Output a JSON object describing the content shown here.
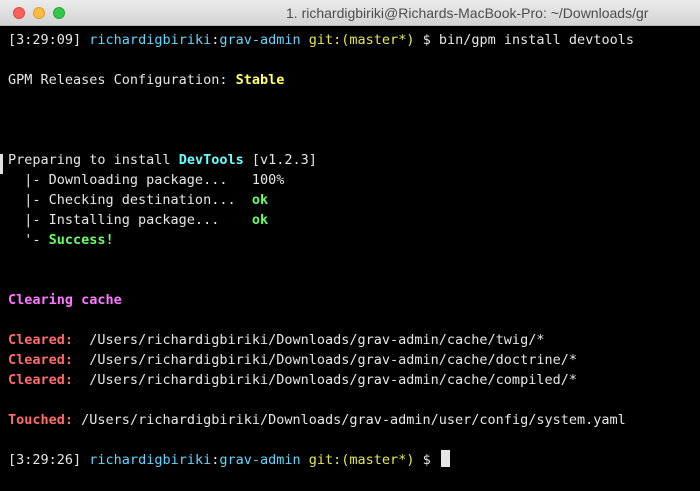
{
  "window": {
    "title": "1. richardigbiriki@Richards-MacBook-Pro: ~/Downloads/gr"
  },
  "prompt1": {
    "time": "[3:29:09]",
    "user": "richardigbiriki",
    "colon": ":",
    "dir": "grav-admin",
    "git": "git:(",
    "branch": "master*",
    "close": ")",
    "dollar": "$",
    "command": "bin/gpm install devtools"
  },
  "gpm": {
    "label": "GPM Releases Configuration: ",
    "value": "Stable"
  },
  "install": {
    "prefix": "Preparing to install ",
    "package": "DevTools",
    "version": " [v1.2.3]",
    "steps": [
      {
        "label": "  |- Downloading package...   ",
        "value": "100%"
      },
      {
        "label": "  |- Checking destination...  ",
        "value": "ok"
      },
      {
        "label": "  |- Installing package...    ",
        "value": "ok"
      }
    ],
    "success_prefix": "  '- ",
    "success": "Success!"
  },
  "cache": {
    "heading": "Clearing cache",
    "cleared_label": "Cleared:",
    "cleared": [
      "/Users/richardigbiriki/Downloads/grav-admin/cache/twig/*",
      "/Users/richardigbiriki/Downloads/grav-admin/cache/doctrine/*",
      "/Users/richardigbiriki/Downloads/grav-admin/cache/compiled/*"
    ],
    "touched_label": "Touched:",
    "touched": "/Users/richardigbiriki/Downloads/grav-admin/user/config/system.yaml"
  },
  "prompt2": {
    "time": "[3:29:26]",
    "user": "richardigbiriki",
    "colon": ":",
    "dir": "grav-admin",
    "git": "git:(",
    "branch": "master*",
    "close": ")",
    "dollar": "$"
  },
  "colors": {
    "background": "#000000",
    "cyan": "#5fd7ff",
    "yellow": "#ffff66",
    "green": "#66ff66",
    "magenta": "#ff77ff",
    "red": "#ff6b6b"
  }
}
